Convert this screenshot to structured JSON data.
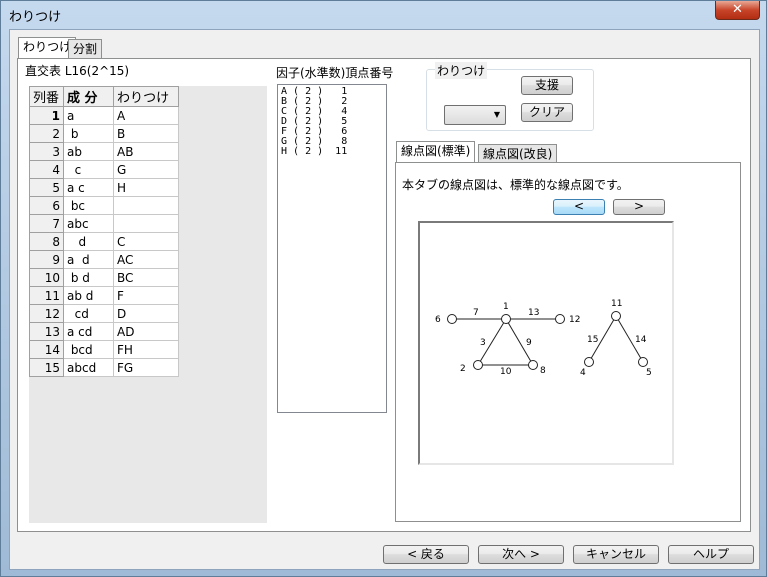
{
  "window": {
    "title": "わりつけ",
    "close_label": "✕"
  },
  "tabs": {
    "main": [
      "わりつけ",
      "分割"
    ],
    "graph": [
      "線点図(標準)",
      "線点図(改良)"
    ]
  },
  "table_label": "直交表  L16(2^15)",
  "grid": {
    "headers": [
      "列番",
      "成 分",
      "わりつけ"
    ],
    "rows": [
      {
        "num": "1",
        "comp": "a",
        "assign": "A"
      },
      {
        "num": "2",
        "comp": " b",
        "assign": "B"
      },
      {
        "num": "3",
        "comp": "ab",
        "assign": "AB"
      },
      {
        "num": "4",
        "comp": "  c",
        "assign": "G"
      },
      {
        "num": "5",
        "comp": "a c",
        "assign": "H"
      },
      {
        "num": "6",
        "comp": " bc",
        "assign": ""
      },
      {
        "num": "7",
        "comp": "abc",
        "assign": ""
      },
      {
        "num": "8",
        "comp": "   d",
        "assign": "C"
      },
      {
        "num": "9",
        "comp": "a  d",
        "assign": "AC"
      },
      {
        "num": "10",
        "comp": " b d",
        "assign": "BC"
      },
      {
        "num": "11",
        "comp": "ab d",
        "assign": "F"
      },
      {
        "num": "12",
        "comp": "  cd",
        "assign": "D"
      },
      {
        "num": "13",
        "comp": "a cd",
        "assign": "AD"
      },
      {
        "num": "14",
        "comp": " bcd",
        "assign": "FH"
      },
      {
        "num": "15",
        "comp": "abcd",
        "assign": "FG"
      }
    ]
  },
  "factor_label": "因子(水準数)頂点番号",
  "factors": [
    "A ( 2 )   1",
    "B ( 2 )   2",
    "C ( 2 )   4",
    "D ( 2 )   5",
    "F ( 2 )   6",
    "G ( 2 )   8",
    "H ( 2 )  11"
  ],
  "assign_group": {
    "title": "わりつけ",
    "support_label": "支援",
    "clear_label": "クリア",
    "combo_value": "",
    "combo_icon": "chevron-down-icon"
  },
  "graph": {
    "description": "本タブの線点図は、標準的な線点図です。",
    "prev_label": "<",
    "next_label": ">",
    "nodes": [
      "1",
      "2",
      "8",
      "6",
      "12",
      "11",
      "4",
      "5"
    ],
    "edges": [
      "7",
      "13",
      "3",
      "9",
      "10",
      "15",
      "14"
    ]
  },
  "footer": {
    "back": "< 戻る",
    "next": "次へ >",
    "cancel": "キャンセル",
    "help": "ヘルプ"
  }
}
